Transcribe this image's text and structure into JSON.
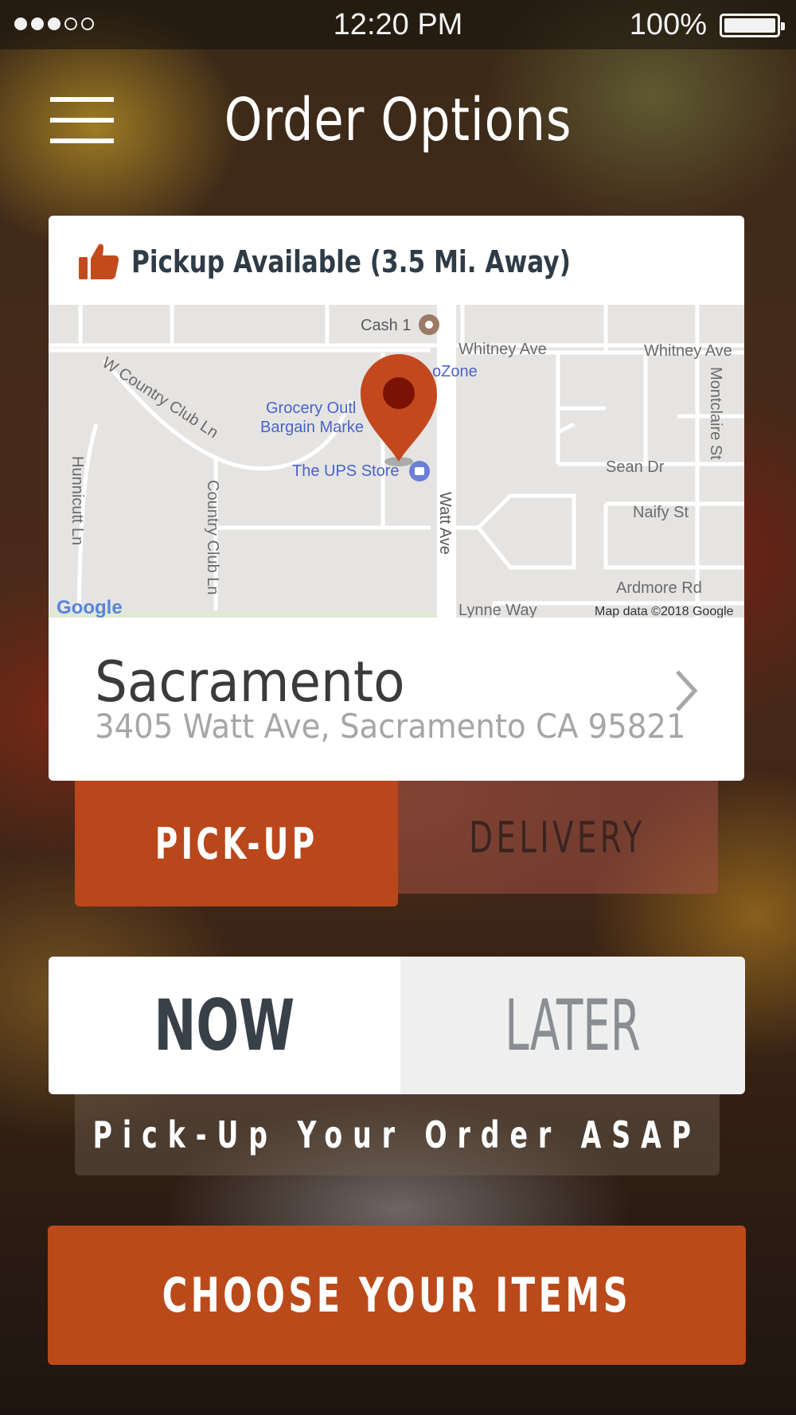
{
  "status_bar": {
    "time": "12:20 PM",
    "battery": "100%",
    "signal_bars_filled": 3,
    "signal_bars_total": 5
  },
  "header": {
    "title": "Order Options"
  },
  "location_card": {
    "availability": "Pickup Available (3.5 Mi. Away)",
    "name": "Sacramento",
    "address": "3405 Watt Ave, Sacramento CA 95821"
  },
  "map": {
    "labels": {
      "cash": "Cash 1",
      "whitney_1": "Whitney Ave",
      "whitney_2": "Whitney Ave",
      "autozone": "oZone",
      "country_club": "W Country Club Ln",
      "grocery_1": "Grocery Outl",
      "grocery_2": "Bargain Marke",
      "ups": "The UPS Store",
      "sean": "Sean Dr",
      "naify": "Naify St",
      "montclaire": "Montclaire St",
      "hunnicutt": "Hunnicutt Ln",
      "country_club_ln": "Country Club Ln",
      "watt": "Watt Ave",
      "ardmore": "Ardmore Rd",
      "lynne": "Lynne Way",
      "google": "Google",
      "attribution": "Map data ©2018 Google"
    }
  },
  "order_mode": {
    "pickup": "PICK-UP",
    "delivery": "DELIVERY",
    "selected": "pickup"
  },
  "order_time": {
    "now": "NOW",
    "later": "LATER",
    "selected": "now",
    "note": "Pick-Up Your Order ASAP"
  },
  "cta": {
    "label": "CHOOSE YOUR ITEMS"
  },
  "colors": {
    "accent": "#b9471b",
    "title_text": "#2f3c47"
  },
  "icons": {
    "menu": "hamburger-menu-icon",
    "thumb": "thumbs-up-icon",
    "chevron": "chevron-right-icon",
    "pin": "map-pin-icon"
  }
}
